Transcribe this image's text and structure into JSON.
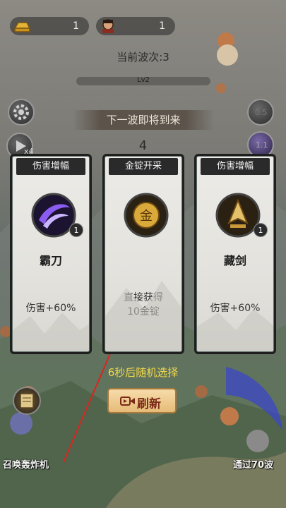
{
  "resources": {
    "gold": {
      "icon": "gold-ingot-icon",
      "value": "1"
    },
    "hero": {
      "icon": "hero-portrait-icon",
      "value": "1"
    }
  },
  "wave": {
    "current_label": "当前波次:3"
  },
  "level": {
    "label": "Lv2"
  },
  "banner": {
    "text": "下一波即将到来"
  },
  "countdown": {
    "value": "4"
  },
  "side_left": {
    "speed_label": "x4",
    "settings_icon": "gear-icon",
    "play_icon": "play-icon"
  },
  "side_right": {
    "skill_a": "0.5",
    "skill_b": "1.1"
  },
  "cards": [
    {
      "title": "伤害增幅",
      "icon": "purple-slash-icon",
      "level": "1",
      "name": "霸刀",
      "effect": "伤害+60%"
    },
    {
      "title": "金锭开采",
      "icon": "gold-coin-icon",
      "level": "",
      "name": "",
      "effect": "直接获得10金锭"
    },
    {
      "title": "伤害增幅",
      "icon": "sword-emblem-icon",
      "level": "1",
      "name": "藏剑",
      "effect": "伤害+60%"
    }
  ],
  "select_hint": "6秒后随机选择",
  "refresh": {
    "label": "刷新",
    "icon": "video-camera-icon"
  },
  "bottom": {
    "left_label": "召唤轰炸机",
    "right_label": "通过70波"
  },
  "colors": {
    "hint_yellow": "#f4d94a",
    "refresh_bg": "#e6bb78",
    "refresh_text": "#7a2a16",
    "card_border": "#1f1f1f"
  }
}
